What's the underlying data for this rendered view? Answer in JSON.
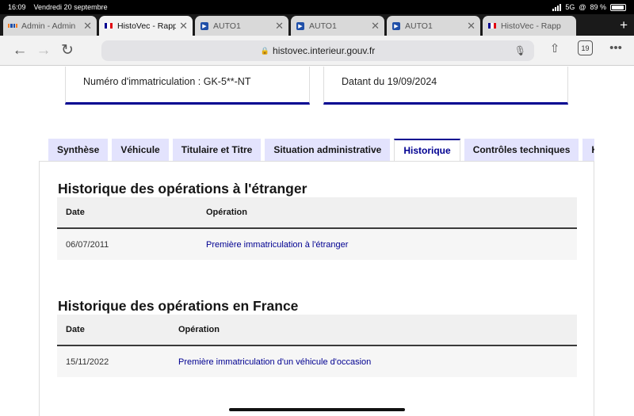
{
  "status_bar": {
    "time": "16:09",
    "date": "Vendredi 20 septembre",
    "network": "5G",
    "battery": "89 %"
  },
  "browser": {
    "tabs": [
      {
        "title": "Admin - Admin",
        "favicon": "admin-grid-icon",
        "active": false
      },
      {
        "title": "HistoVec - Rapp",
        "favicon": "french-flag-icon",
        "active": true
      },
      {
        "title": "AUTO1",
        "favicon": "auto1-icon",
        "active": false
      },
      {
        "title": "AUTO1",
        "favicon": "auto1-icon",
        "active": false
      },
      {
        "title": "AUTO1",
        "favicon": "auto1-icon",
        "active": false
      },
      {
        "title": "HistoVec - Rapp",
        "favicon": "french-flag-icon",
        "active": false
      }
    ],
    "url": "histovec.interieur.gouv.fr",
    "tab_count": "19"
  },
  "info_cards": {
    "registration": "Numéro d'immatriculation : GK-5**-NT",
    "date": "Datant du 19/09/2024"
  },
  "report_tabs": [
    {
      "label": "Synthèse",
      "active": false
    },
    {
      "label": "Véhicule",
      "active": false
    },
    {
      "label": "Titulaire et Titre",
      "active": false
    },
    {
      "label": "Situation administrative",
      "active": false
    },
    {
      "label": "Historique",
      "active": true
    },
    {
      "label": "Contrôles techniques",
      "active": false
    },
    {
      "label": "Kilo",
      "active": false
    }
  ],
  "foreign_history": {
    "title": "Historique des opérations à l'étranger",
    "columns": [
      "Date",
      "Opération"
    ],
    "rows": [
      {
        "date": "06/07/2011",
        "operation": "Première immatriculation à l'étranger"
      }
    ]
  },
  "france_history": {
    "title": "Historique des opérations en France",
    "columns": [
      "Date",
      "Opération"
    ],
    "rows": [
      {
        "date": "15/11/2022",
        "operation": "Première immatriculation d'un véhicule d'occasion"
      }
    ]
  },
  "colors": {
    "accent": "#000091",
    "tab_bg": "#e3e3fd",
    "table_head": "#f0f0f0"
  }
}
